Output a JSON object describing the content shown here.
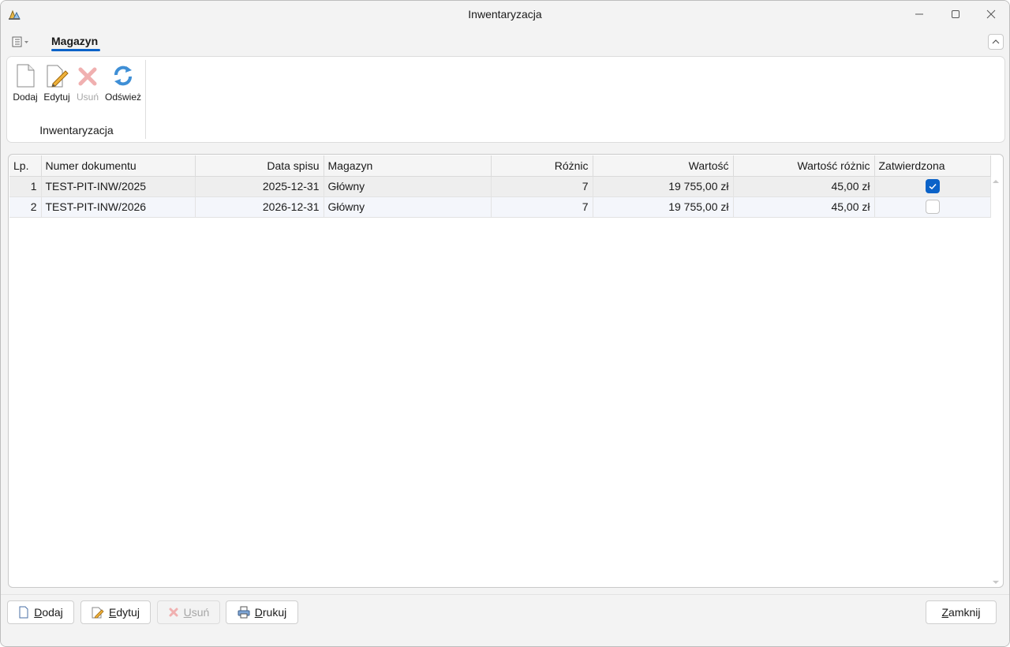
{
  "window": {
    "title": "Inwentaryzacja"
  },
  "ribbon": {
    "tab": "Magazyn",
    "group_label": "Inwentaryzacja",
    "buttons": {
      "add": "Dodaj",
      "edit": "Edytuj",
      "delete": "Usuń",
      "refresh": "Odśwież"
    }
  },
  "table": {
    "columns": [
      "Lp.",
      "Numer dokumentu",
      "Data spisu",
      "Magazyn",
      "Różnic",
      "Wartość",
      "Wartość różnic",
      "Zatwierdzona"
    ],
    "rows": [
      {
        "lp": "1",
        "numer": "TEST-PIT-INW/2025",
        "data": "2025-12-31",
        "magazyn": "Główny",
        "roznic": "7",
        "wartosc": "19 755,00 zł",
        "wartosc_roznic": "45,00 zł",
        "zatwierdzona": true
      },
      {
        "lp": "2",
        "numer": "TEST-PIT-INW/2026",
        "data": "2026-12-31",
        "magazyn": "Główny",
        "roznic": "7",
        "wartosc": "19 755,00 zł",
        "wartosc_roznic": "45,00 zł",
        "zatwierdzona": false
      }
    ]
  },
  "footer": {
    "add": {
      "hotkey": "D",
      "rest": "odaj"
    },
    "edit": {
      "hotkey": "E",
      "rest": "dytuj"
    },
    "delete": {
      "hotkey": "U",
      "rest": "suń"
    },
    "print": {
      "hotkey": "D",
      "rest": "rukuj"
    },
    "close": {
      "hotkey": "Z",
      "rest": "amknij"
    }
  },
  "colors": {
    "accent": "#0a62c8",
    "window_bg": "#f3f3f3"
  }
}
